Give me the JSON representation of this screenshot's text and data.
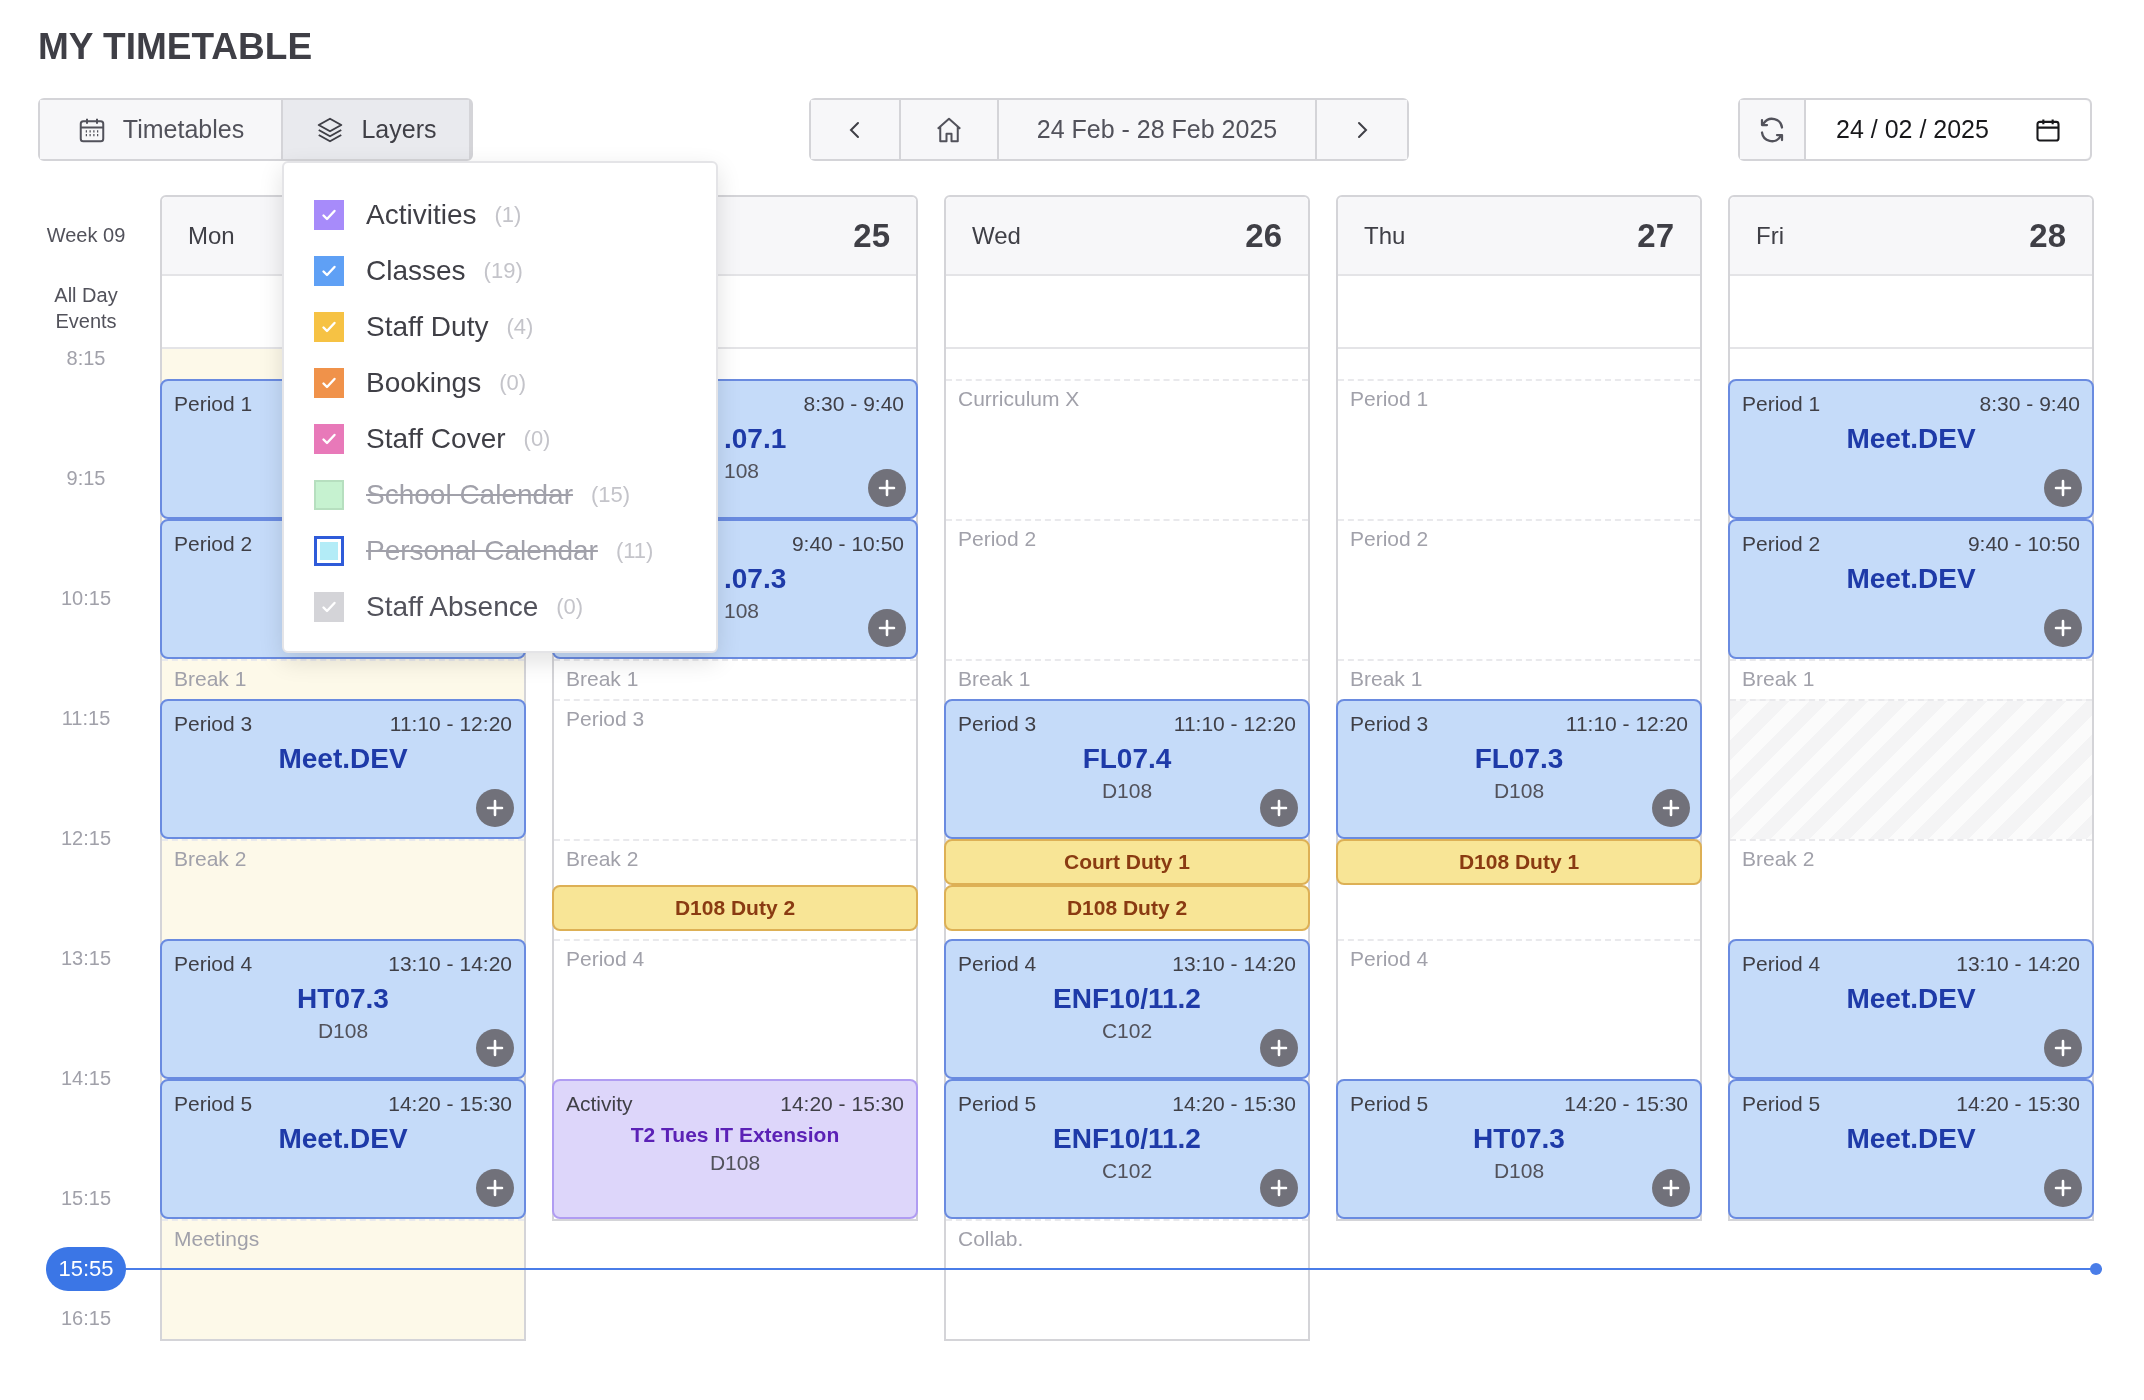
{
  "title": "MY TIMETABLE",
  "view_tabs": [
    {
      "label": "Timetables",
      "selected": false
    },
    {
      "label": "Layers",
      "selected": true
    }
  ],
  "week_range": "24 Feb - 28 Feb 2025",
  "date_field": {
    "value": "24 / 02 / 2025"
  },
  "layers": {
    "items": [
      {
        "label": "Activities",
        "count": "(1)",
        "checked": true,
        "disabled": false,
        "focused": false,
        "color": "#a78bfa"
      },
      {
        "label": "Classes",
        "count": "(19)",
        "checked": true,
        "disabled": false,
        "focused": false,
        "color": "#5fa0f5"
      },
      {
        "label": "Staff Duty",
        "count": "(4)",
        "checked": true,
        "disabled": false,
        "focused": false,
        "color": "#f6c244"
      },
      {
        "label": "Bookings",
        "count": "(0)",
        "checked": true,
        "disabled": false,
        "focused": false,
        "color": "#f0924a"
      },
      {
        "label": "Staff Cover",
        "count": "(0)",
        "checked": true,
        "disabled": false,
        "focused": false,
        "color": "#e879b9"
      },
      {
        "label": "School Calendar",
        "count": "(15)",
        "checked": false,
        "disabled": false,
        "focused": false,
        "color": "#c6f2d0"
      },
      {
        "label": "Personal Calendar",
        "count": "(11)",
        "checked": false,
        "disabled": false,
        "focused": true,
        "color": "#b3ecf7"
      },
      {
        "label": "Staff Absence",
        "count": "(0)",
        "checked": true,
        "disabled": true,
        "focused": false,
        "color": "#d4d4d8"
      }
    ]
  },
  "week_label": "Week 09",
  "all_day_label": "All Day Events",
  "time_labels": [
    "8:15",
    "9:15",
    "10:15",
    "11:15",
    "12:15",
    "13:15",
    "14:15",
    "15:15",
    "16:15"
  ],
  "now": "15:55",
  "days": [
    {
      "name": "Mon",
      "today": true,
      "items": [
        {
          "kind": "class",
          "label": "Period 1"
        },
        {
          "kind": "class",
          "label": "Period 2"
        },
        {
          "kind": "break",
          "label": "Break 1"
        },
        {
          "kind": "class",
          "label": "Period 3",
          "time": "11:10 - 12:20",
          "title": "Meet.DEV",
          "addable": true,
          "covered": false
        },
        {
          "kind": "break",
          "label": "Break 2"
        },
        {
          "kind": "class",
          "label": "Period 4",
          "time": "13:10 - 14:20",
          "title": "HT07.3",
          "room": "D108",
          "addable": true,
          "covered": false
        },
        {
          "kind": "class",
          "label": "Period 5",
          "time": "14:20 - 15:30",
          "title": "Meet.DEV",
          "addable": true,
          "covered": false
        },
        {
          "kind": "slot",
          "label": "Meetings"
        }
      ]
    },
    {
      "date": "25",
      "today": false,
      "items": [
        {
          "kind": "class",
          "time": "8:30 - 9:40",
          "title": ".07.1",
          "room": "108",
          "addable": true,
          "covered": true
        },
        {
          "kind": "class",
          "time": "9:40 - 10:50",
          "title": ".07.3",
          "room": "108",
          "addable": true,
          "covered": true
        },
        {
          "kind": "break",
          "label": "Break 1"
        },
        {
          "kind": "slot",
          "label": "Period 3"
        },
        {
          "kind": "break",
          "label": "Break 2",
          "duties": [
            {
              "kind": "second",
              "title": "D108 Duty 2"
            }
          ]
        },
        {
          "kind": "slot",
          "label": "Period 4"
        },
        {
          "kind": "activity",
          "label": "Activity",
          "time": "14:20 - 15:30",
          "title": "T2 Tues IT Extension",
          "room": "D108"
        }
      ]
    },
    {
      "name": "Wed",
      "date": "26",
      "today": false,
      "items": [
        {
          "kind": "slot",
          "label": "Curriculum X"
        },
        {
          "kind": "slot",
          "label": "Period 2"
        },
        {
          "kind": "break",
          "label": "Break 1"
        },
        {
          "kind": "class",
          "label": "Period 3",
          "time": "11:10 - 12:20",
          "title": "FL07.4",
          "room": "D108",
          "addable": true,
          "covered": false
        },
        {
          "kind": "break",
          "duties": [
            {
              "kind": "first",
              "title": "Court Duty 1"
            },
            {
              "kind": "second",
              "title": "D108 Duty 2"
            }
          ]
        },
        {
          "kind": "class",
          "label": "Period 4",
          "time": "13:10 - 14:20",
          "title": "ENF10/11.2",
          "room": "C102",
          "addable": true,
          "covered": false
        },
        {
          "kind": "class",
          "label": "Period 5",
          "time": "14:20 - 15:30",
          "title": "ENF10/11.2",
          "room": "C102",
          "addable": true,
          "covered": false
        },
        {
          "kind": "slot",
          "label": "Collab."
        }
      ]
    },
    {
      "name": "Thu",
      "date": "27",
      "today": false,
      "items": [
        {
          "kind": "slot",
          "label": "Period 1"
        },
        {
          "kind": "slot",
          "label": "Period 2"
        },
        {
          "kind": "break",
          "label": "Break 1"
        },
        {
          "kind": "class",
          "label": "Period 3",
          "time": "11:10 - 12:20",
          "title": "FL07.3",
          "room": "D108",
          "addable": true,
          "covered": false
        },
        {
          "kind": "break",
          "duties": [
            {
              "kind": "first",
              "title": "D108 Duty 1"
            }
          ]
        },
        {
          "kind": "slot",
          "label": "Period 4"
        },
        {
          "kind": "class",
          "label": "Period 5",
          "time": "14:20 - 15:30",
          "title": "HT07.3",
          "room": "D108",
          "addable": true,
          "covered": false
        }
      ]
    },
    {
      "name": "Fri",
      "date": "28",
      "today": false,
      "items": [
        {
          "kind": "class",
          "label": "Period 1",
          "time": "8:30 - 9:40",
          "title": "Meet.DEV",
          "addable": true,
          "covered": false
        },
        {
          "kind": "class",
          "label": "Period 2",
          "time": "9:40 - 10:50",
          "title": "Meet.DEV",
          "addable": true,
          "covered": false
        },
        {
          "kind": "break",
          "label": "Break 1"
        },
        {
          "kind": "blocked"
        },
        {
          "kind": "break",
          "label": "Break 2"
        },
        {
          "kind": "class",
          "label": "Period 4",
          "time": "13:10 - 14:20",
          "title": "Meet.DEV",
          "addable": true,
          "covered": false
        },
        {
          "kind": "class",
          "label": "Period 5",
          "time": "14:20 - 15:30",
          "title": "Meet.DEV",
          "addable": true,
          "covered": false
        }
      ]
    }
  ]
}
